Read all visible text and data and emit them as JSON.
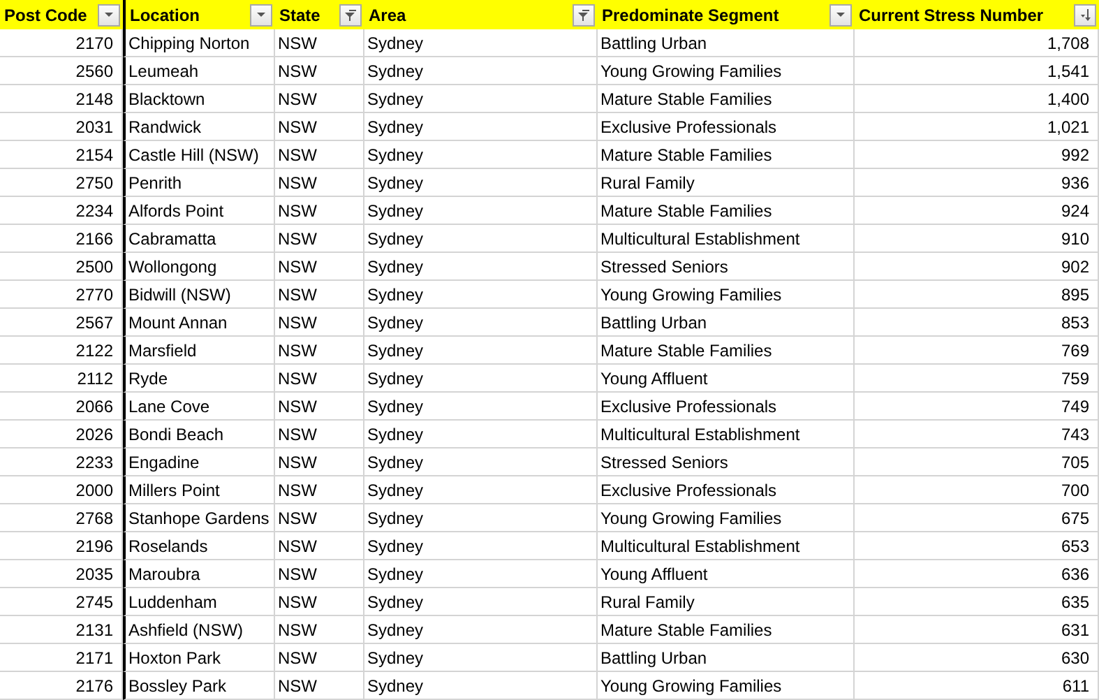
{
  "columns": [
    {
      "label": "Post Code",
      "kind": "dropdown"
    },
    {
      "label": "Location",
      "kind": "dropdown"
    },
    {
      "label": "State",
      "kind": "filtered"
    },
    {
      "label": "Area",
      "kind": "filtered"
    },
    {
      "label": "Predominate Segment",
      "kind": "dropdown"
    },
    {
      "label": "Current Stress Number",
      "kind": "sorted"
    }
  ],
  "rows": [
    [
      "2170",
      "Chipping Norton",
      "NSW",
      "Sydney",
      "Battling Urban",
      "1,708"
    ],
    [
      "2560",
      "Leumeah",
      "NSW",
      "Sydney",
      "Young Growing Families",
      "1,541"
    ],
    [
      "2148",
      "Blacktown",
      "NSW",
      "Sydney",
      "Mature Stable Families",
      "1,400"
    ],
    [
      "2031",
      "Randwick",
      "NSW",
      "Sydney",
      "Exclusive Professionals",
      "1,021"
    ],
    [
      "2154",
      "Castle Hill (NSW)",
      "NSW",
      "Sydney",
      "Mature Stable Families",
      "992"
    ],
    [
      "2750",
      "Penrith",
      "NSW",
      "Sydney",
      "Rural Family",
      "936"
    ],
    [
      "2234",
      "Alfords Point",
      "NSW",
      "Sydney",
      "Mature Stable Families",
      "924"
    ],
    [
      "2166",
      "Cabramatta",
      "NSW",
      "Sydney",
      "Multicultural Establishment",
      "910"
    ],
    [
      "2500",
      "Wollongong",
      "NSW",
      "Sydney",
      "Stressed Seniors",
      "902"
    ],
    [
      "2770",
      "Bidwill (NSW)",
      "NSW",
      "Sydney",
      "Young Growing Families",
      "895"
    ],
    [
      "2567",
      "Mount Annan",
      "NSW",
      "Sydney",
      "Battling Urban",
      "853"
    ],
    [
      "2122",
      "Marsfield",
      "NSW",
      "Sydney",
      "Mature Stable Families",
      "769"
    ],
    [
      "2112",
      "Ryde",
      "NSW",
      "Sydney",
      "Young Affluent",
      "759"
    ],
    [
      "2066",
      "Lane Cove",
      "NSW",
      "Sydney",
      "Exclusive Professionals",
      "749"
    ],
    [
      "2026",
      "Bondi Beach",
      "NSW",
      "Sydney",
      "Multicultural Establishment",
      "743"
    ],
    [
      "2233",
      "Engadine",
      "NSW",
      "Sydney",
      "Stressed Seniors",
      "705"
    ],
    [
      "2000",
      "Millers Point",
      "NSW",
      "Sydney",
      "Exclusive Professionals",
      "700"
    ],
    [
      "2768",
      "Stanhope Gardens",
      "NSW",
      "Sydney",
      "Young Growing Families",
      "675"
    ],
    [
      "2196",
      "Roselands",
      "NSW",
      "Sydney",
      "Multicultural Establishment",
      "653"
    ],
    [
      "2035",
      "Maroubra",
      "NSW",
      "Sydney",
      "Young Affluent",
      "636"
    ],
    [
      "2745",
      "Luddenham",
      "NSW",
      "Sydney",
      "Rural Family",
      "635"
    ],
    [
      "2131",
      "Ashfield (NSW)",
      "NSW",
      "Sydney",
      "Mature Stable Families",
      "631"
    ],
    [
      "2171",
      "Hoxton Park",
      "NSW",
      "Sydney",
      "Battling Urban",
      "630"
    ],
    [
      "2176",
      "Bossley Park",
      "NSW",
      "Sydney",
      "Young Growing Families",
      "611"
    ]
  ]
}
